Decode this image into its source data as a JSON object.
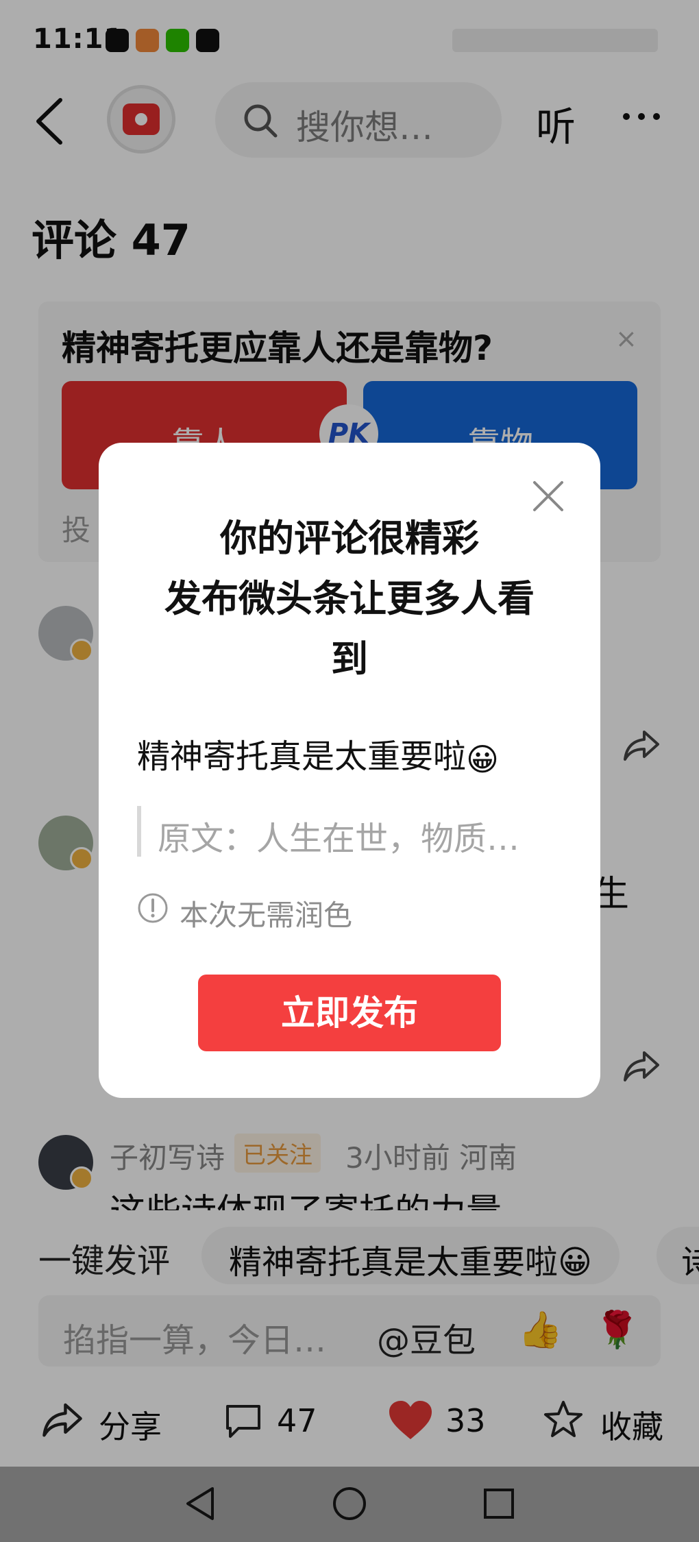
{
  "status_bar": {
    "time": "11:11"
  },
  "header": {
    "search_placeholder": "搜你想…",
    "listen_label": "听"
  },
  "comments_header": {
    "title": "评论 47"
  },
  "pk_card": {
    "question": "精神寄托更应靠人还是靠物?",
    "option_left": "靠人",
    "option_right": "靠物",
    "badge": "PK",
    "vote_prefix": "投",
    "close_symbol": "×"
  },
  "background_comments": {
    "partial_char": "生",
    "third": {
      "name": "子初写诗",
      "follow_badge": "已关注",
      "time_location": "3小时前  河南",
      "text": "这些诗体现了寄托的力量"
    }
  },
  "quick_reply": {
    "label": "一键发评",
    "chip_text": "精神寄托真是太重要啦😀",
    "chip_partial": "诗"
  },
  "input_bar": {
    "placeholder": "掐指一算，今日…",
    "mention": "@豆包",
    "thumb_emoji": "👍",
    "rose_emoji": "🌹"
  },
  "bottom_actions": {
    "share": "分享",
    "comments": "47",
    "likes": "33",
    "favorite": "收藏"
  },
  "modal": {
    "title_line1": "你的评论很精彩",
    "title_line2": "发布微头条让更多人看",
    "title_line3": "到",
    "comment_text": "精神寄托真是太重要啦",
    "comment_emoji": "😀",
    "original_text": "原文：人生在世，物质…",
    "info_text": "本次无需润色",
    "publish_button": "立即发布"
  },
  "colors": {
    "accent_red": "#f43f3f",
    "pk_red": "#e03030",
    "pk_blue": "#1568d8",
    "like_red": "#e53935"
  }
}
